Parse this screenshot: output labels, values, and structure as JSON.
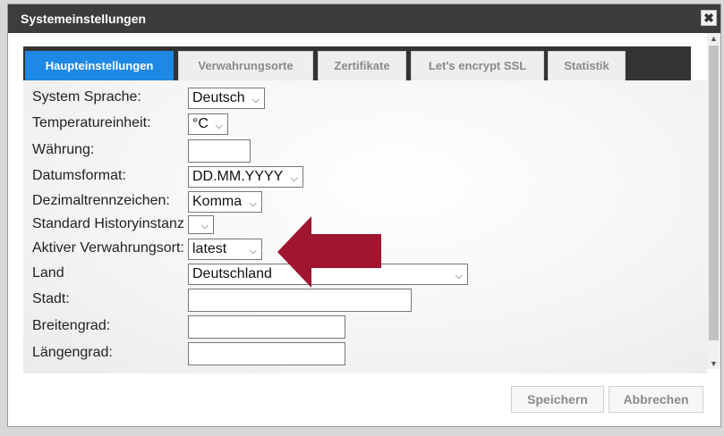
{
  "dialog": {
    "title": "Systemeinstellungen",
    "close_glyph": "✖"
  },
  "tabs": [
    {
      "label": "Haupteinstellungen",
      "active": true
    },
    {
      "label": "Verwahrungsorte",
      "active": false
    },
    {
      "label": "Zertifikate",
      "active": false
    },
    {
      "label": "Let's encrypt SSL",
      "active": false
    },
    {
      "label": "Statistik",
      "active": false
    }
  ],
  "form": {
    "system_language": {
      "label": "System Sprache:",
      "value": "Deutsch"
    },
    "temperature_unit": {
      "label": "Temperatureinheit:",
      "value": "°C"
    },
    "currency": {
      "label": "Währung:",
      "value": ""
    },
    "date_format": {
      "label": "Datumsformat:",
      "value": "DD.MM.YYYY"
    },
    "decimal_separator": {
      "label": "Dezimaltrennzeichen:",
      "value": "Komma"
    },
    "history_instance": {
      "label": "Standard Historyinstanz",
      "value": ""
    },
    "active_storage": {
      "label": "Aktiver Verwahrungsort:",
      "value": "latest"
    },
    "country": {
      "label": "Land",
      "value": "Deutschland"
    },
    "city": {
      "label": "Stadt:",
      "value": ""
    },
    "latitude": {
      "label": "Breitengrad:",
      "value": ""
    },
    "longitude": {
      "label": "Längengrad:",
      "value": ""
    }
  },
  "dropdown_glyph": "⌵",
  "buttons": {
    "save": "Speichern",
    "cancel": "Abbrechen"
  },
  "annotation_color": "#a01530",
  "active_tab_color": "#1e88e5",
  "titlebar_color": "#3c3c3c"
}
